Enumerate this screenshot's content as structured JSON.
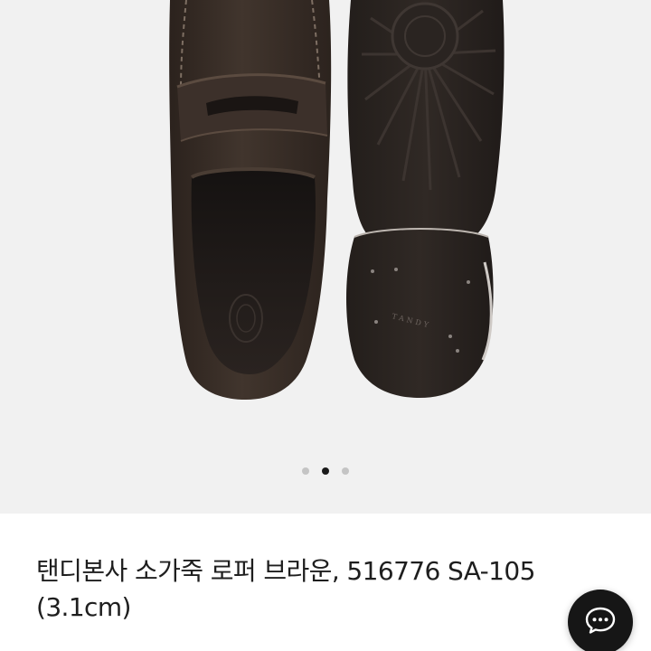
{
  "product": {
    "title": "탠디본사 소가죽 로퍼 브라운, 516776 SA-105 (3.1cm)",
    "image_alt": "product-photo"
  },
  "gallery": {
    "total_images": 3,
    "current_index": 2,
    "active_dot_color": "#1a1a1a",
    "inactive_dot_color": "#c4c4c4"
  },
  "sole_stamp": "TANDY",
  "chat": {
    "icon": "chat-bubble-icon"
  },
  "colors": {
    "background": "#f1f1f1",
    "suede": "#3a2f28",
    "sole": "#2b2522"
  }
}
